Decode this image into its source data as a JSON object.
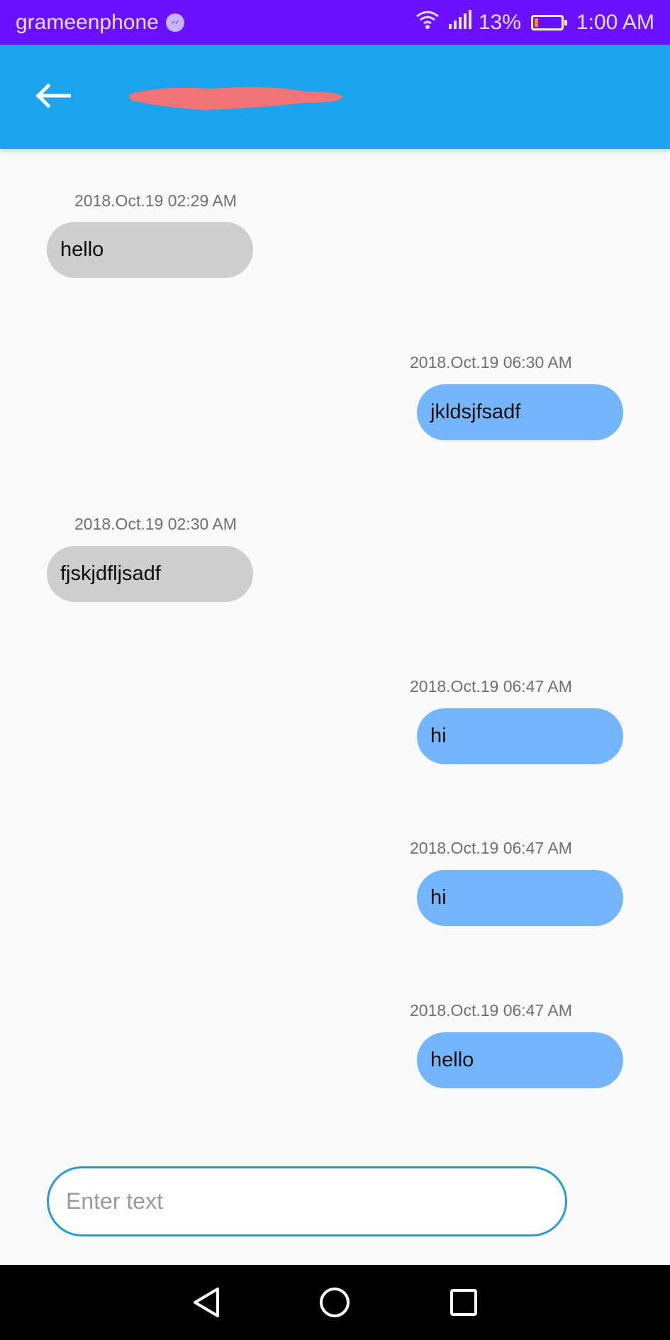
{
  "status_bar": {
    "carrier": "grameenphone",
    "battery_percent": "13%",
    "battery_level": 0.13,
    "time": "1:00 AM",
    "icons": [
      "messenger-icon",
      "wifi-icon",
      "signal-icon",
      "battery-icon"
    ]
  },
  "app_bar": {
    "back_icon": "arrow-left-icon",
    "title_redacted": true
  },
  "messages": [
    {
      "direction": "received",
      "timestamp": "2018.Oct.19 02:29 AM",
      "text": "hello"
    },
    {
      "direction": "sent",
      "timestamp": "2018.Oct.19 06:30 AM",
      "text": "jkldsjfsadf"
    },
    {
      "direction": "received",
      "timestamp": "2018.Oct.19 02:30 AM",
      "text": "fjskjdfljsadf"
    },
    {
      "direction": "sent",
      "timestamp": "2018.Oct.19 06:47 AM",
      "text": "hi"
    },
    {
      "direction": "sent",
      "timestamp": "2018.Oct.19 06:47 AM",
      "text": "hi"
    },
    {
      "direction": "sent",
      "timestamp": "2018.Oct.19 06:47 AM",
      "text": "hello"
    }
  ],
  "composer": {
    "placeholder": "Enter text",
    "value": ""
  },
  "nav_bar": {
    "icons": [
      "back-triangle-icon",
      "home-circle-icon",
      "recents-square-icon"
    ]
  },
  "colors": {
    "status_bar": "#6a11ff",
    "app_bar": "#1ba3ec",
    "received_bubble": "#cdced0",
    "sent_bubble": "#74b6fe",
    "input_border": "#2b9ad6",
    "redaction": "#f07476"
  }
}
